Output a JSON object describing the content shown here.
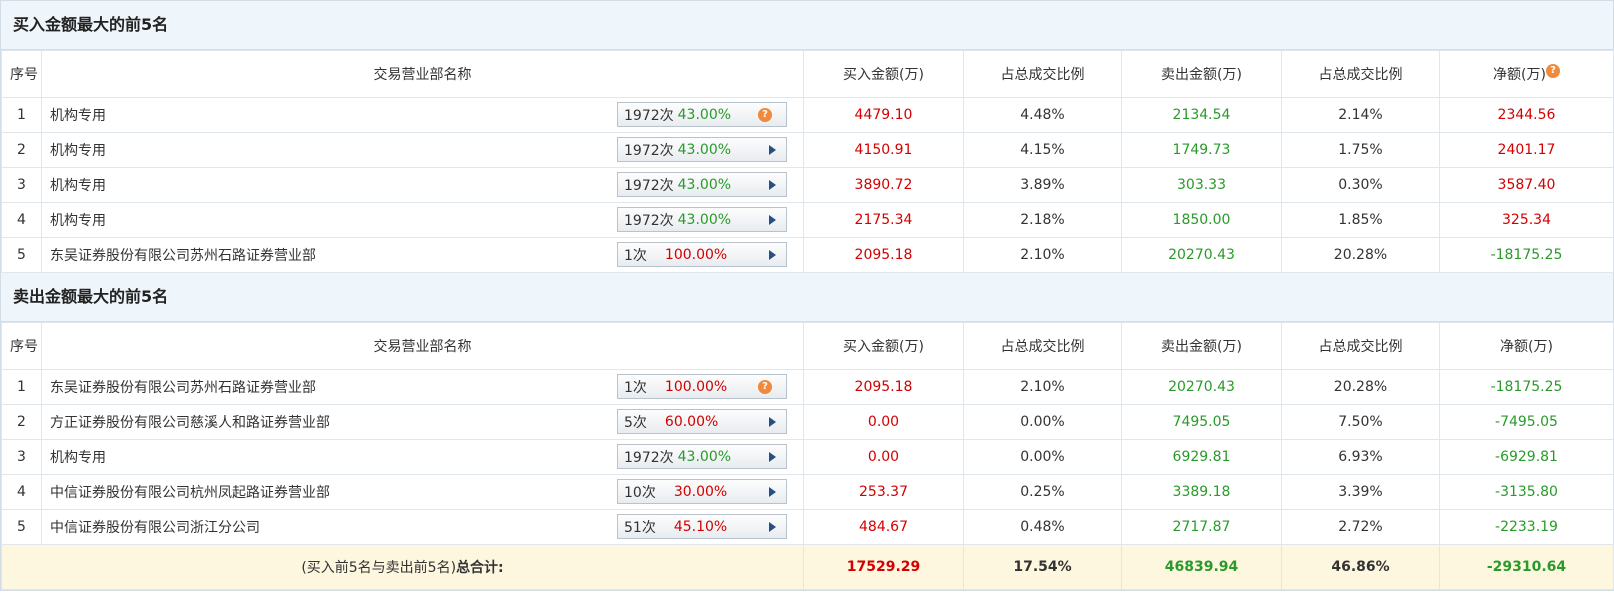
{
  "buy_section": {
    "title": "买入金额最大的前5名",
    "headers": [
      "序号",
      "交易营业部名称",
      "买入金额(万)",
      "占总成交比例",
      "卖出金额(万)",
      "占总成交比例",
      "净额(万)"
    ],
    "rows": [
      {
        "no": "1",
        "name": "机构专用",
        "count": "1972次",
        "rate": "43.00%",
        "buy": "4479.10",
        "buy_pct": "4.48%",
        "sell": "2134.54",
        "sell_pct": "2.14%",
        "net": "2344.56",
        "icon": "question"
      },
      {
        "no": "2",
        "name": "机构专用",
        "count": "1972次",
        "rate": "43.00%",
        "buy": "4150.91",
        "buy_pct": "4.15%",
        "sell": "1749.73",
        "sell_pct": "1.75%",
        "net": "2401.17",
        "icon": "arrow"
      },
      {
        "no": "3",
        "name": "机构专用",
        "count": "1972次",
        "rate": "43.00%",
        "buy": "3890.72",
        "buy_pct": "3.89%",
        "sell": "303.33",
        "sell_pct": "0.30%",
        "net": "3587.40",
        "icon": "arrow"
      },
      {
        "no": "4",
        "name": "机构专用",
        "count": "1972次",
        "rate": "43.00%",
        "buy": "2175.34",
        "buy_pct": "2.18%",
        "sell": "1850.00",
        "sell_pct": "1.85%",
        "net": "325.34",
        "icon": "arrow"
      },
      {
        "no": "5",
        "name": "东吴证券股份有限公司苏州石路证券营业部",
        "count": "1次",
        "rate": "100.00%",
        "buy": "2095.18",
        "buy_pct": "2.10%",
        "sell": "20270.43",
        "sell_pct": "20.28%",
        "net": "-18175.25",
        "icon": "arrow"
      }
    ]
  },
  "sell_section": {
    "title": "卖出金额最大的前5名",
    "headers": [
      "序号",
      "交易营业部名称",
      "买入金额(万)",
      "占总成交比例",
      "卖出金额(万)",
      "占总成交比例",
      "净额(万)"
    ],
    "rows": [
      {
        "no": "1",
        "name": "东吴证券股份有限公司苏州石路证券营业部",
        "count": "1次",
        "rate": "100.00%",
        "buy": "2095.18",
        "buy_pct": "2.10%",
        "sell": "20270.43",
        "sell_pct": "20.28%",
        "net": "-18175.25",
        "icon": "question"
      },
      {
        "no": "2",
        "name": "方正证券股份有限公司慈溪人和路证券营业部",
        "count": "5次",
        "rate": "60.00%",
        "buy": "0.00",
        "buy_pct": "0.00%",
        "sell": "7495.05",
        "sell_pct": "7.50%",
        "net": "-7495.05",
        "icon": "arrow"
      },
      {
        "no": "3",
        "name": "机构专用",
        "count": "1972次",
        "rate": "43.00%",
        "buy": "0.00",
        "buy_pct": "0.00%",
        "sell": "6929.81",
        "sell_pct": "6.93%",
        "net": "-6929.81",
        "icon": "arrow"
      },
      {
        "no": "4",
        "name": "中信证券股份有限公司杭州凤起路证券营业部",
        "count": "10次",
        "rate": "30.00%",
        "buy": "253.37",
        "buy_pct": "0.25%",
        "sell": "3389.18",
        "sell_pct": "3.39%",
        "net": "-3135.80",
        "icon": "arrow"
      },
      {
        "no": "5",
        "name": "中信证券股份有限公司浙江分公司",
        "count": "51次",
        "rate": "45.10%",
        "buy": "484.67",
        "buy_pct": "0.48%",
        "sell": "2717.87",
        "sell_pct": "2.72%",
        "net": "-2233.19",
        "icon": "arrow"
      }
    ],
    "total": {
      "label_prefix": "(买入前5名与卖出前5名)",
      "label_bold": "总合计:",
      "buy": "17529.29",
      "buy_pct": "17.54%",
      "sell": "46839.94",
      "sell_pct": "46.86%",
      "net": "-29310.64"
    }
  },
  "colors": {
    "positive": "#d40000",
    "negative": "#2a9a2a",
    "header_bg": "#eef5fb",
    "total_bg": "#fdf7df",
    "help_icon": "#f08a3a"
  }
}
